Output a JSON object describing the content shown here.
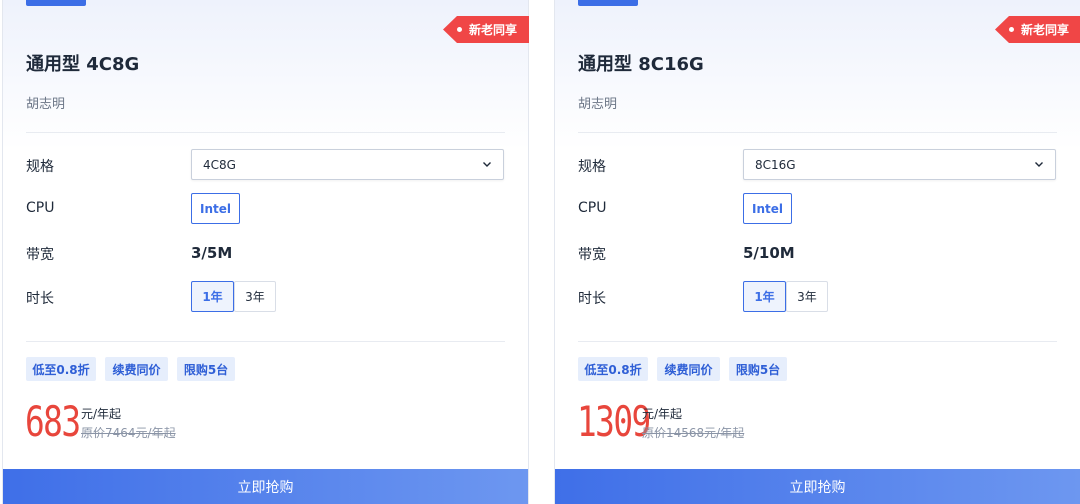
{
  "cards": [
    {
      "badge": "新老同享",
      "title": "通用型 4C8G",
      "owner": "胡志明",
      "labels": {
        "spec": "规格",
        "cpu": "CPU",
        "bandwidth": "带宽",
        "duration": "时长"
      },
      "spec_selected": "4C8G",
      "cpu_option": "Intel",
      "bandwidth_value": "3/5M",
      "duration_options": [
        "1年",
        "3年"
      ],
      "tags": [
        "低至0.8折",
        "续费同价",
        "限购5台"
      ],
      "price": "683",
      "price_unit": "元/年起",
      "original_price": "原价7464元/年起",
      "buy_label": "立即抢购"
    },
    {
      "badge": "新老同享",
      "title": "通用型 8C16G",
      "owner": "胡志明",
      "labels": {
        "spec": "规格",
        "cpu": "CPU",
        "bandwidth": "带宽",
        "duration": "时长"
      },
      "spec_selected": "8C16G",
      "cpu_option": "Intel",
      "bandwidth_value": "5/10M",
      "duration_options": [
        "1年",
        "3年"
      ],
      "tags": [
        "低至0.8折",
        "续费同价",
        "限购5台"
      ],
      "price": "1309",
      "price_unit": "元/年起",
      "original_price": "原价14568元/年起",
      "buy_label": "立即抢购"
    }
  ],
  "colors": {
    "accent": "#3c6ee6",
    "price": "#e8463c",
    "badge": "#f04646",
    "tag_bg": "#e6eefc"
  }
}
